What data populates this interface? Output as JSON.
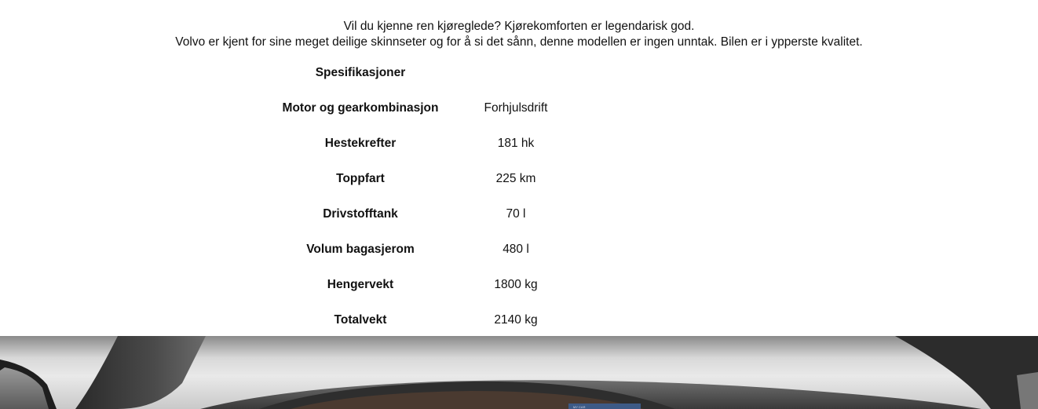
{
  "intro": {
    "line1": "Vil du kjenne ren kjøreglede? Kjørekomforten er legendarisk god.",
    "line2": "Volvo er kjent for sine meget deilige skinnseter og for å si det sånn, denne modellen er ingen unntak. Bilen er i ypperste kvalitet."
  },
  "specs": {
    "heading": "Spesifikasjoner",
    "rows": [
      {
        "label": "Motor og gearkombinasjon",
        "value": "Forhjulsdrift"
      },
      {
        "label": "Hestekrefter",
        "value": "181 hk"
      },
      {
        "label": "Toppfart",
        "value": "225 km"
      },
      {
        "label": "Drivstofftank",
        "value": "70 l"
      },
      {
        "label": "Volum bagasjerom",
        "value": "480 l"
      },
      {
        "label": "Hengervekt",
        "value": "1800 kg"
      },
      {
        "label": "Totalvekt",
        "value": "2140 kg"
      }
    ]
  },
  "hero": {
    "screen_text": "MY CAR"
  }
}
